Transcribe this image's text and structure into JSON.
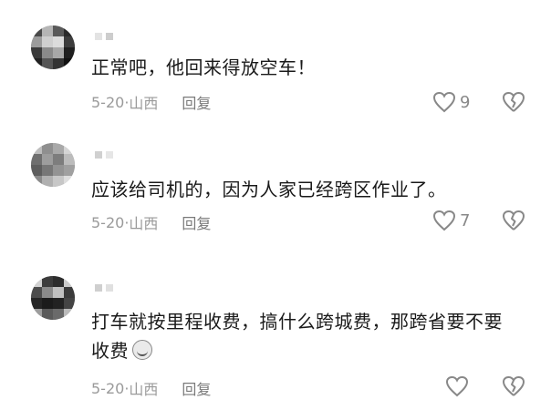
{
  "comments": [
    {
      "text": "正常吧，他回来得放空车！",
      "date": "5-20",
      "location": "山西",
      "reply_label": "回复",
      "likes": "9"
    },
    {
      "text": "应该给司机的，因为人家已经跨区作业了。",
      "date": "5-20",
      "location": "山西",
      "reply_label": "回复",
      "likes": "7"
    },
    {
      "text": "打车就按里程收费，搞什么跨城费，那跨省要不要收费",
      "date": "5-20",
      "location": "山西",
      "reply_label": "回复",
      "likes": ""
    }
  ],
  "icons": {
    "like": "heart-outline-icon",
    "dislike": "broken-heart-icon",
    "emoji": "laugh-emoji-icon"
  },
  "colors": {
    "text": "#1a1a1a",
    "meta": "#9a9a9a",
    "icon": "#888888"
  }
}
